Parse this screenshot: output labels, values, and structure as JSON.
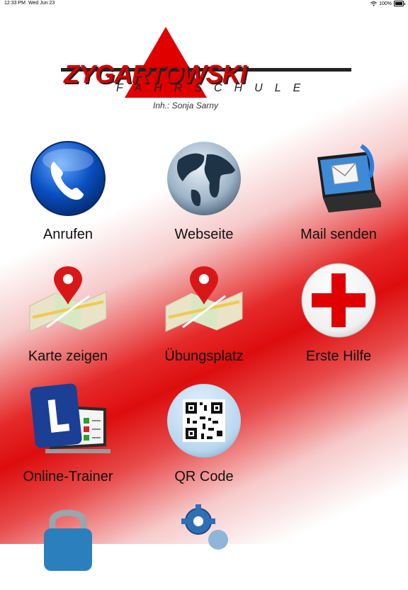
{
  "status_bar": {
    "time": "12:33 PM",
    "date": "Wed Jun 23",
    "battery": "100%"
  },
  "logo": {
    "brand": "ZYGARTOWSKI",
    "subtitle": "FAHRSCHULE",
    "owner": "Inh.: Sonja Sarny"
  },
  "tiles": [
    {
      "label": "Anrufen",
      "icon": "phone-icon"
    },
    {
      "label": "Webseite",
      "icon": "globe-icon"
    },
    {
      "label": "Mail senden",
      "icon": "mail-laptop-icon"
    },
    {
      "label": "Karte zeigen",
      "icon": "map-pin-icon"
    },
    {
      "label": "Übungsplatz",
      "icon": "map-pin-icon"
    },
    {
      "label": "Erste Hilfe",
      "icon": "first-aid-cross-icon"
    },
    {
      "label": "Online-Trainer",
      "icon": "learner-trainer-icon"
    },
    {
      "label": "QR Code",
      "icon": "qr-code-icon"
    },
    {
      "label": "",
      "icon": "padlock-icon"
    },
    {
      "label": "",
      "icon": "gears-icon"
    }
  ],
  "colors": {
    "accent": "#dd0d0d",
    "text": "#111111"
  }
}
